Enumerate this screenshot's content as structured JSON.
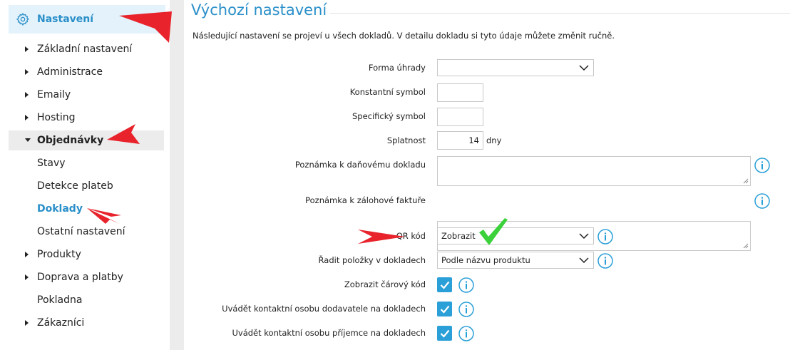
{
  "sidebar": {
    "header": "Nastavení",
    "items": [
      {
        "label": "Základní nastavení"
      },
      {
        "label": "Administrace"
      },
      {
        "label": "Emaily"
      },
      {
        "label": "Hosting"
      },
      {
        "label": "Objednávky"
      },
      {
        "label": "Stavy"
      },
      {
        "label": "Detekce plateb"
      },
      {
        "label": "Doklady"
      },
      {
        "label": "Ostatní nastavení"
      },
      {
        "label": "Produkty"
      },
      {
        "label": "Doprava a platby"
      },
      {
        "label": "Pokladna"
      },
      {
        "label": "Zákazníci"
      }
    ]
  },
  "main": {
    "title": "Výchozí nastavení",
    "description": "Následující nastavení se projeví u všech dokladů. V detailu dokladu si tyto údaje můžete změnit ručně.",
    "fields": {
      "payment_form": {
        "label": "Forma úhrady",
        "value": ""
      },
      "constant_symbol": {
        "label": "Konstantní symbol",
        "value": ""
      },
      "specific_symbol": {
        "label": "Specifický symbol",
        "value": ""
      },
      "due": {
        "label": "Splatnost",
        "value": "14",
        "suffix": "dny"
      },
      "tax_note": {
        "label": "Poznámka k daňovému dokladu",
        "value": ""
      },
      "advance_note": {
        "label": "Poznámka k zálohové faktuře",
        "value": ""
      },
      "qr_code": {
        "label": "QR kód",
        "value": "Zobrazit"
      },
      "sort_items": {
        "label": "Řadit položky v dokladech",
        "value": "Podle názvu produktu"
      },
      "barcode": {
        "label": "Zobrazit čárový kód",
        "checked": true
      },
      "supplier_contact": {
        "label": "Uvádět kontaktní osobu dodavatele na dokladech",
        "checked": true
      },
      "recipient_contact": {
        "label": "Uvádět kontaktní osobu příjemce na dokladech",
        "checked": true
      }
    }
  },
  "colors": {
    "accent": "#2a8fc9",
    "checkbox": "#2a9fd8",
    "annotation_arrow": "#e8232b",
    "annotation_check": "#3ad13a"
  }
}
